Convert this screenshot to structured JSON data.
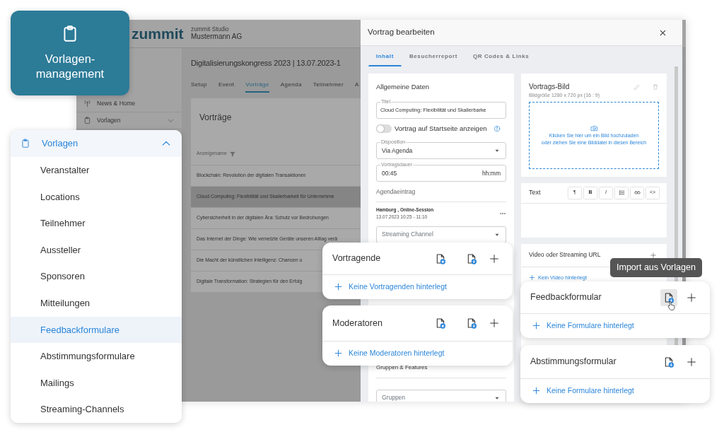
{
  "badge": {
    "title": "Vorlagen-management"
  },
  "app": {
    "logo": "zummit",
    "org_label": "zummit Studio",
    "org_name": "Mustermann AG",
    "sidebar": [
      {
        "label": "News & Home",
        "kind": "news"
      },
      {
        "label": "Vorlagen",
        "kind": "group",
        "expanded": false
      }
    ],
    "event_title": "Digitalisierungskongress 2023 | 13.07.2023-1",
    "tabs": [
      {
        "label": "Setup",
        "selected": false
      },
      {
        "label": "Event",
        "selected": false
      },
      {
        "label": "Vorträge",
        "selected": true
      },
      {
        "label": "Agenda",
        "selected": false
      },
      {
        "label": "Teilnehmer",
        "selected": false
      },
      {
        "label": "A",
        "selected": false
      }
    ],
    "list_title": "Vorträge",
    "column": "Anzeigename",
    "rows": [
      {
        "text": "Blockchain: Revolution der digitalen Transaktionen",
        "selected": false
      },
      {
        "text": "Cloud Computing: Flexibilität und Skalierbarkeit für Unternehme",
        "selected": true
      },
      {
        "text": "Cybersicherheit in der digitalen Ära: Schutz vor Bedrohungen",
        "selected": false
      },
      {
        "text": "Das Internet der Dinge: Wie vernetzte Geräte unseren Alltag verä",
        "selected": false
      },
      {
        "text": "Die Macht der künstlichen Intelligenz: Chancen u",
        "selected": false
      },
      {
        "text": "Digitale Transformation: Strategien für den Erfolg",
        "selected": false
      }
    ]
  },
  "dialog": {
    "title": "Vortrag bearbeiten",
    "tabs": [
      {
        "label": "Inhalt",
        "selected": true
      },
      {
        "label": "Besucherreport",
        "selected": false
      },
      {
        "label": "QR Codes & Links",
        "selected": false
      }
    ],
    "general": {
      "heading": "Allgemeine Daten",
      "title_label": "Titel",
      "title_value": "Cloud Computing: Flexibilität und Skalierbarke",
      "toggle_label": "Vortrag auf Startseite anzeigen",
      "toggle_on": false,
      "disposition_label": "Disposition",
      "disposition_value": "Via Agenda",
      "duration_label": "Vortragsdauer",
      "duration_value": "00:45",
      "duration_unit": "hh:mm",
      "agenda_heading": "Agendaeintrag",
      "agenda_place": "Hamburg , Online-Session",
      "agenda_time": "13.07.2023 10:25 - 11:10",
      "streaming_placeholder": "Streaming Channel",
      "groups_heading": "Gruppen & Features",
      "groups_placeholder": "Gruppen"
    },
    "image": {
      "heading": "Vortrags-Bild",
      "hint": "Bildgröße 1280 x 720 px (16 : 9)",
      "drop_lines": [
        "Klicken Sie hier um ein Bild hochzuladen",
        "oder ziehen Sie eine Bilddatei in diesen Bereich"
      ]
    },
    "text_editor": {
      "heading": "Text",
      "tools": [
        {
          "kind": "char",
          "label": "¶"
        },
        {
          "kind": "bold",
          "label": "B"
        },
        {
          "kind": "italic",
          "label": "I"
        },
        {
          "kind": "list"
        },
        {
          "kind": "link"
        },
        {
          "kind": "char",
          "label": "<>"
        }
      ]
    },
    "video": {
      "heading": "Video oder Streaming URL",
      "empty": "Kein Video hinterlegt"
    }
  },
  "menu": {
    "title": "Vorlagen",
    "expanded": true,
    "items": [
      {
        "label": "Veranstalter",
        "selected": false
      },
      {
        "label": "Locations",
        "selected": false
      },
      {
        "label": "Teilnehmer",
        "selected": false
      },
      {
        "label": "Aussteller",
        "selected": false
      },
      {
        "label": "Sponsoren",
        "selected": false
      },
      {
        "label": "Mitteilungen",
        "selected": false
      },
      {
        "label": "Feedbackformulare",
        "selected": true
      },
      {
        "label": "Abstimmungsformulare",
        "selected": false
      },
      {
        "label": "Mailings",
        "selected": false
      },
      {
        "label": "Streaming-Channels",
        "selected": false
      }
    ]
  },
  "cards": [
    {
      "title": "Vortragende",
      "buttons": [
        {
          "kind": "template",
          "hovered": false
        },
        {
          "kind": "import",
          "hovered": false
        },
        {
          "kind": "add",
          "hovered": false
        }
      ],
      "empty": "Keine Vortragenden hinterlegt"
    },
    {
      "title": "Moderatoren",
      "buttons": [
        {
          "kind": "template",
          "hovered": false
        },
        {
          "kind": "import",
          "hovered": false
        },
        {
          "kind": "add",
          "hovered": false
        }
      ],
      "empty": "Keine Moderatoren hinterlegt"
    },
    {
      "title": "Feedbackformular",
      "buttons": [
        {
          "kind": "import",
          "hovered": true
        },
        {
          "kind": "add",
          "hovered": false
        }
      ],
      "empty": "Keine Formulare hinterlegt"
    },
    {
      "title": "Abstimmungsformular",
      "buttons": [
        {
          "kind": "import",
          "hovered": false
        },
        {
          "kind": "add",
          "hovered": false
        }
      ],
      "empty": "Keine Formulare hinterlegt"
    }
  ],
  "tooltip": "Import aus Vorlagen"
}
